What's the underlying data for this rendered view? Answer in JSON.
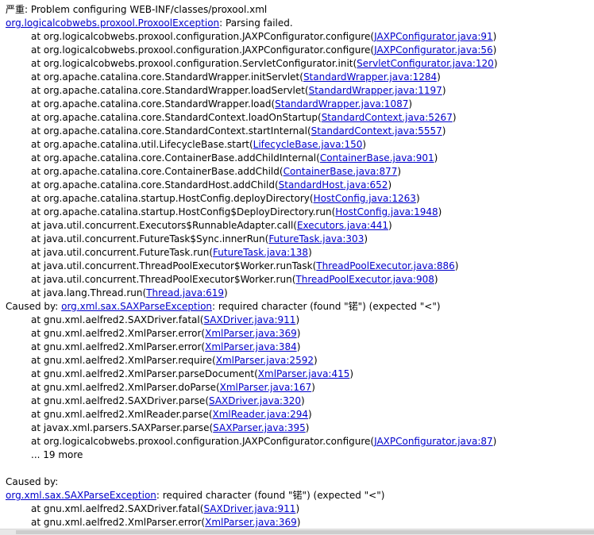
{
  "console": {
    "lines": [
      {
        "kind": "plain",
        "text": "严重: Problem configuring WEB-INF/classes/proxool.xml"
      },
      {
        "kind": "exception",
        "link": "org.logicalcobwebs.proxool.ProxoolException",
        "rest": ": Parsing failed."
      },
      {
        "kind": "frame",
        "before": "at org.logicalcobwebs.proxool.configuration.JAXPConfigurator.configure(",
        "link": "JAXPConfigurator.java:91",
        "after": ")"
      },
      {
        "kind": "frame",
        "before": "at org.logicalcobwebs.proxool.configuration.JAXPConfigurator.configure(",
        "link": "JAXPConfigurator.java:56",
        "after": ")"
      },
      {
        "kind": "frame",
        "before": "at org.logicalcobwebs.proxool.configuration.ServletConfigurator.init(",
        "link": "ServletConfigurator.java:120",
        "after": ")"
      },
      {
        "kind": "frame",
        "before": "at org.apache.catalina.core.StandardWrapper.initServlet(",
        "link": "StandardWrapper.java:1284",
        "after": ")"
      },
      {
        "kind": "frame",
        "before": "at org.apache.catalina.core.StandardWrapper.loadServlet(",
        "link": "StandardWrapper.java:1197",
        "after": ")"
      },
      {
        "kind": "frame",
        "before": "at org.apache.catalina.core.StandardWrapper.load(",
        "link": "StandardWrapper.java:1087",
        "after": ")"
      },
      {
        "kind": "frame",
        "before": "at org.apache.catalina.core.StandardContext.loadOnStartup(",
        "link": "StandardContext.java:5267",
        "after": ")"
      },
      {
        "kind": "frame",
        "before": "at org.apache.catalina.core.StandardContext.startInternal(",
        "link": "StandardContext.java:5557",
        "after": ")"
      },
      {
        "kind": "frame",
        "before": "at org.apache.catalina.util.LifecycleBase.start(",
        "link": "LifecycleBase.java:150",
        "after": ")"
      },
      {
        "kind": "frame",
        "before": "at org.apache.catalina.core.ContainerBase.addChildInternal(",
        "link": "ContainerBase.java:901",
        "after": ")"
      },
      {
        "kind": "frame",
        "before": "at org.apache.catalina.core.ContainerBase.addChild(",
        "link": "ContainerBase.java:877",
        "after": ")"
      },
      {
        "kind": "frame",
        "before": "at org.apache.catalina.core.StandardHost.addChild(",
        "link": "StandardHost.java:652",
        "after": ")"
      },
      {
        "kind": "frame",
        "before": "at org.apache.catalina.startup.HostConfig.deployDirectory(",
        "link": "HostConfig.java:1263",
        "after": ")"
      },
      {
        "kind": "frame",
        "before": "at org.apache.catalina.startup.HostConfig$DeployDirectory.run(",
        "link": "HostConfig.java:1948",
        "after": ")"
      },
      {
        "kind": "frame",
        "before": "at java.util.concurrent.Executors$RunnableAdapter.call(",
        "link": "Executors.java:441",
        "after": ")"
      },
      {
        "kind": "frame",
        "before": "at java.util.concurrent.FutureTask$Sync.innerRun(",
        "link": "FutureTask.java:303",
        "after": ")"
      },
      {
        "kind": "frame",
        "before": "at java.util.concurrent.FutureTask.run(",
        "link": "FutureTask.java:138",
        "after": ")"
      },
      {
        "kind": "frame",
        "before": "at java.util.concurrent.ThreadPoolExecutor$Worker.runTask(",
        "link": "ThreadPoolExecutor.java:886",
        "after": ")"
      },
      {
        "kind": "frame",
        "before": "at java.util.concurrent.ThreadPoolExecutor$Worker.run(",
        "link": "ThreadPoolExecutor.java:908",
        "after": ")"
      },
      {
        "kind": "frame",
        "before": "at java.lang.Thread.run(",
        "link": "Thread.java:619",
        "after": ")"
      },
      {
        "kind": "caused",
        "before": "Caused by: ",
        "link": "org.xml.sax.SAXParseException",
        "after": ": required character (found \"锘\") (expected \"<\")"
      },
      {
        "kind": "frame",
        "before": "at gnu.xml.aelfred2.SAXDriver.fatal(",
        "link": "SAXDriver.java:911",
        "after": ")"
      },
      {
        "kind": "frame",
        "before": "at gnu.xml.aelfred2.XmlParser.error(",
        "link": "XmlParser.java:369",
        "after": ")"
      },
      {
        "kind": "frame",
        "before": "at gnu.xml.aelfred2.XmlParser.error(",
        "link": "XmlParser.java:384",
        "after": ")"
      },
      {
        "kind": "frame",
        "before": "at gnu.xml.aelfred2.XmlParser.require(",
        "link": "XmlParser.java:2592",
        "after": ")"
      },
      {
        "kind": "frame",
        "before": "at gnu.xml.aelfred2.XmlParser.parseDocument(",
        "link": "XmlParser.java:415",
        "after": ")"
      },
      {
        "kind": "frame",
        "before": "at gnu.xml.aelfred2.XmlParser.doParse(",
        "link": "XmlParser.java:167",
        "after": ")"
      },
      {
        "kind": "frame",
        "before": "at gnu.xml.aelfred2.SAXDriver.parse(",
        "link": "SAXDriver.java:320",
        "after": ")"
      },
      {
        "kind": "frame",
        "before": "at gnu.xml.aelfred2.XmlReader.parse(",
        "link": "XmlReader.java:294",
        "after": ")"
      },
      {
        "kind": "frame",
        "before": "at javax.xml.parsers.SAXParser.parse(",
        "link": "SAXParser.java:395",
        "after": ")"
      },
      {
        "kind": "frame",
        "before": "at org.logicalcobwebs.proxool.configuration.JAXPConfigurator.configure(",
        "link": "JAXPConfigurator.java:87",
        "after": ")"
      },
      {
        "kind": "more",
        "text": "... 19 more"
      },
      {
        "kind": "blank",
        "text": ""
      },
      {
        "kind": "plain",
        "text": "Caused by:"
      },
      {
        "kind": "exception",
        "link": "org.xml.sax.SAXParseException",
        "rest": ": required character (found \"锘\") (expected \"<\")"
      },
      {
        "kind": "frame",
        "before": "at gnu.xml.aelfred2.SAXDriver.fatal(",
        "link": "SAXDriver.java:911",
        "after": ")"
      },
      {
        "kind": "frame",
        "before": "at gnu.xml.aelfred2.XmlParser.error(",
        "link": "XmlParser.java:369",
        "after": ")"
      }
    ]
  },
  "colors": {
    "link": "#0000cc",
    "text": "#000000",
    "background": "#ffffff"
  }
}
